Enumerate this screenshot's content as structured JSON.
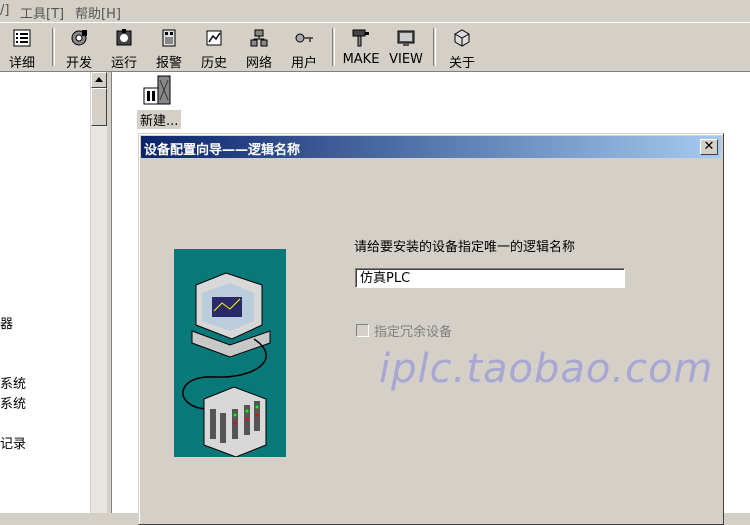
{
  "menubar": {
    "items": [
      "/]",
      "工具[T]",
      "帮助[H]"
    ]
  },
  "toolbar": {
    "buttons": [
      {
        "label": "详细",
        "icon": "list-icon"
      },
      {
        "label": "开发",
        "icon": "develop-icon"
      },
      {
        "label": "运行",
        "icon": "run-icon"
      },
      {
        "label": "报警",
        "icon": "alarm-icon"
      },
      {
        "label": "历史",
        "icon": "history-icon"
      },
      {
        "label": "网络",
        "icon": "network-icon"
      },
      {
        "label": "用户",
        "icon": "user-key-icon"
      },
      {
        "label": "MAKE",
        "icon": "make-icon"
      },
      {
        "label": "VIEW",
        "icon": "view-icon"
      },
      {
        "label": "关于",
        "icon": "about-icon"
      }
    ]
  },
  "tree": {
    "items": [
      "器",
      "系统",
      "系统",
      "记录"
    ]
  },
  "content": {
    "new_item_label": "新建..."
  },
  "dialog": {
    "title": "设备配置向导——逻辑名称",
    "close_label": "✕",
    "prompt": "请给要安装的设备指定唯一的逻辑名称",
    "name_value": "仿真PLC",
    "checkbox_label": "指定冗余设备",
    "checkbox_checked": false,
    "watermark": "iplc.taobao.com"
  },
  "colors": {
    "title_start": "#0a246a",
    "title_end": "#a6caf0",
    "wizard_bg": "#087878",
    "watermark": "#9a9ad8"
  }
}
